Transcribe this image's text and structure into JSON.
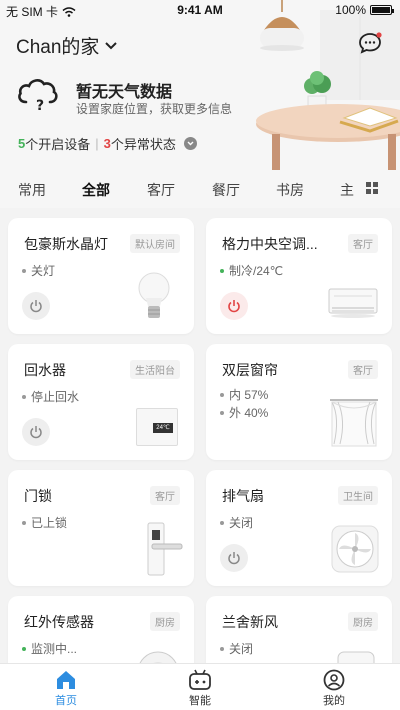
{
  "status_bar": {
    "carrier": "无 SIM 卡",
    "time": "9:41 AM",
    "battery": "100%"
  },
  "header": {
    "home_name": "Chan的家",
    "weather_title": "暂无天气数据",
    "weather_subtitle": "设置家庭位置，获取更多信息",
    "active_devices_count": "5",
    "active_devices_label": "个开启设备",
    "abnormal_count": "3",
    "abnormal_label": "个异常状态"
  },
  "tabs": [
    "常用",
    "全部",
    "客厅",
    "餐厅",
    "书房",
    "主"
  ],
  "active_tab": "全部",
  "devices": [
    {
      "name": "包豪斯水晶灯",
      "room": "默认房间",
      "status": [
        "关灯"
      ],
      "power_on": false,
      "icon": "bulb-icon"
    },
    {
      "name": "格力中央空调...",
      "room": "客厅",
      "status": [
        "制冷/24℃"
      ],
      "power_on": true,
      "icon": "air-conditioner-icon"
    },
    {
      "name": "回水器",
      "room": "生活阳台",
      "status": [
        "停止回水"
      ],
      "power_on": false,
      "icon": "water-heater-icon",
      "display": "24℃"
    },
    {
      "name": "双层窗帘",
      "room": "客厅",
      "status": [
        "内 57%",
        "外 40%"
      ],
      "power_on": false,
      "icon": "curtain-icon"
    },
    {
      "name": "门锁",
      "room": "客厅",
      "status": [
        "已上锁"
      ],
      "power_on": false,
      "icon": "door-lock-icon"
    },
    {
      "name": "排气扇",
      "room": "卫生间",
      "status": [
        "关闭"
      ],
      "power_on": false,
      "icon": "exhaust-fan-icon"
    },
    {
      "name": "红外传感器",
      "room": "厨房",
      "status": [
        "监测中..."
      ],
      "power_on": false,
      "icon": "infrared-sensor-icon"
    },
    {
      "name": "兰舍新风",
      "room": "厨房",
      "status": [
        "关闭"
      ],
      "power_on": false,
      "icon": "fresh-air-icon"
    }
  ],
  "bottom_nav": [
    {
      "label": "首页",
      "icon": "home-icon"
    },
    {
      "label": "智能",
      "icon": "robot-icon"
    },
    {
      "label": "我的",
      "icon": "profile-icon"
    }
  ],
  "colors": {
    "accent": "#2d8de0",
    "green": "#44b35a",
    "red": "#e24444"
  }
}
